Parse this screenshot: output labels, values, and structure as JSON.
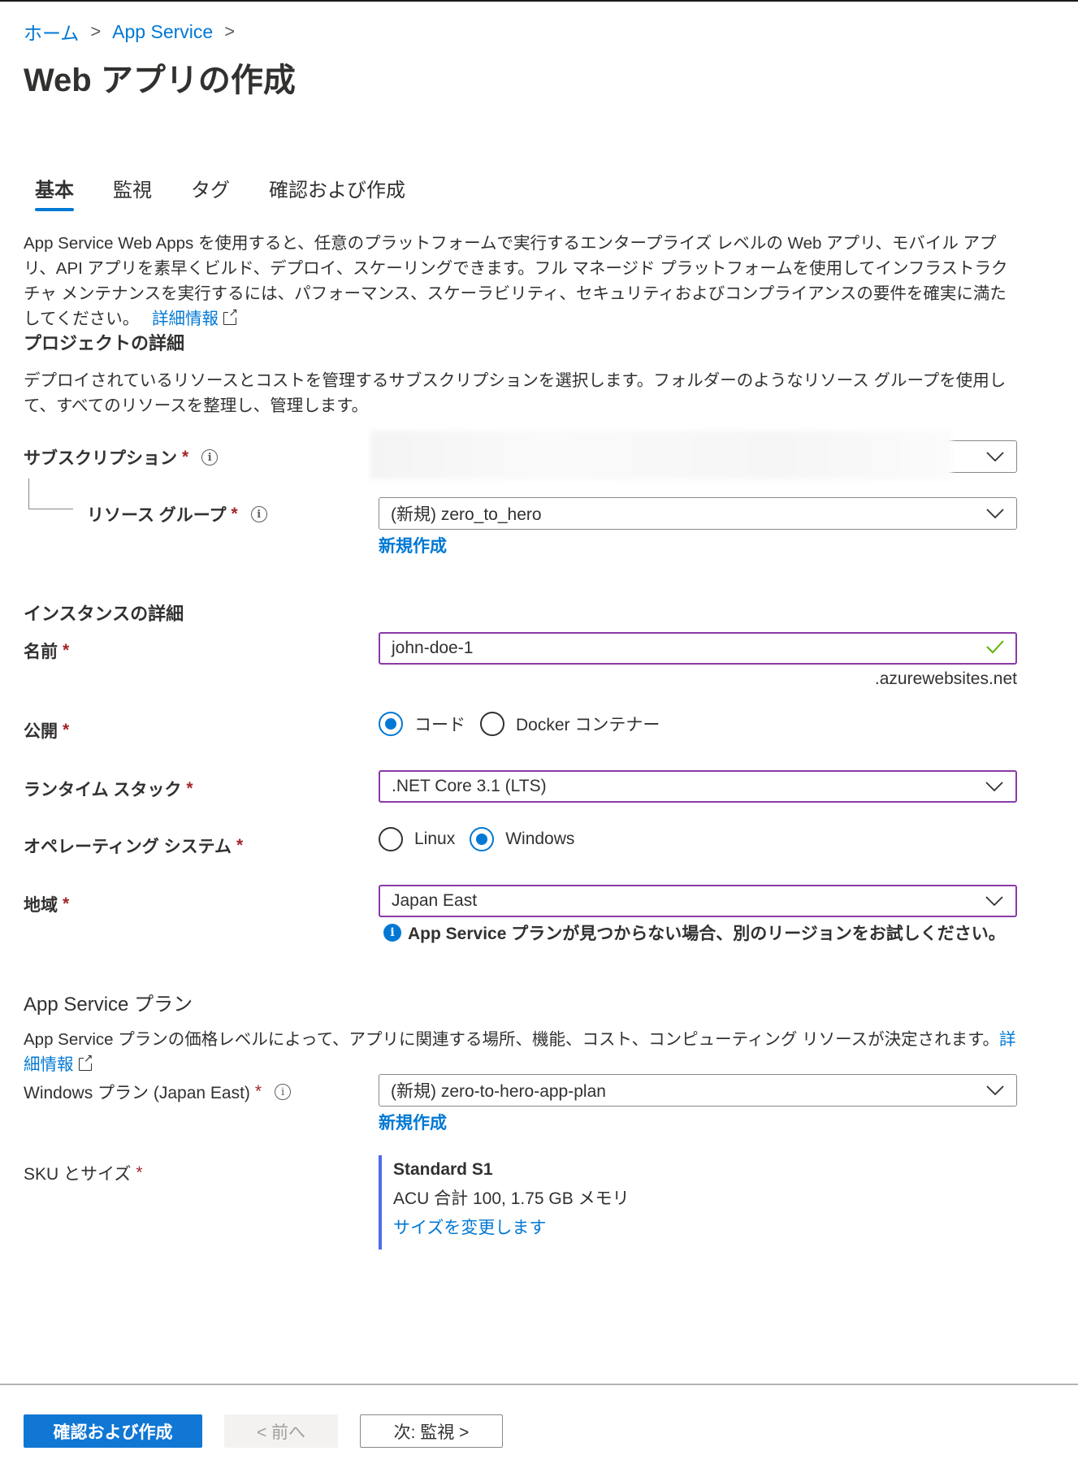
{
  "breadcrumb": [
    {
      "label": "ホーム"
    },
    {
      "label": "App Service"
    }
  ],
  "breadcrumb_separator": ">",
  "page_title": "Web アプリの作成",
  "tabs": [
    {
      "label": "基本",
      "active": true
    },
    {
      "label": "監視",
      "active": false
    },
    {
      "label": "タグ",
      "active": false
    },
    {
      "label": "確認および作成",
      "active": false
    }
  ],
  "intro": {
    "text": "App Service Web Apps を使用すると、任意のプラットフォームで実行するエンタープライズ レベルの Web アプリ、モバイル アプリ、API アプリを素早くビルド、デプロイ、スケーリングできます。フル マネージド プラットフォームを使用してインフラストラクチャ メンテナンスを実行するには、パフォーマンス、スケーラビリティ、セキュリティおよびコンプライアンスの要件を確実に満たしてください。",
    "link": "詳細情報"
  },
  "project": {
    "heading": "プロジェクトの詳細",
    "description": "デプロイされているリソースとコストを管理するサブスクリプションを選択します。フォルダーのようなリソース グループを使用して、すべてのリソースを整理し、管理します。",
    "subscription_label": "サブスクリプション",
    "subscription_value": "",
    "resource_group_label": "リソース グループ",
    "resource_group_value": "(新規) zero_to_hero",
    "create_new": "新規作成"
  },
  "instance": {
    "heading": "インスタンスの詳細",
    "name_label": "名前",
    "name_value": "john-doe-1",
    "name_suffix": ".azurewebsites.net",
    "publish_label": "公開",
    "publish_options": [
      {
        "label": "コード",
        "checked": true
      },
      {
        "label": "Docker コンテナー",
        "checked": false
      }
    ],
    "runtime_label": "ランタイム スタック",
    "runtime_value": ".NET Core 3.1 (LTS)",
    "os_label": "オペレーティング システム",
    "os_options": [
      {
        "label": "Linux",
        "checked": false
      },
      {
        "label": "Windows",
        "checked": true
      }
    ],
    "region_label": "地域",
    "region_value": "Japan East",
    "region_notice": "App Service プランが見つからない場合、別のリージョンをお試しください。"
  },
  "plan": {
    "heading": "App Service プラン",
    "description": "App Service プランの価格レベルによって、アプリに関連する場所、機能、コスト、コンピューティング リソースが決定されます。",
    "link": "詳細情報",
    "plan_label": "Windows プラン (Japan East)",
    "plan_value": "(新規) zero-to-hero-app-plan",
    "create_new": "新規作成",
    "sku_label": "SKU とサイズ",
    "sku_name": "Standard S1",
    "sku_detail": "ACU 合計 100, 1.75 GB メモリ",
    "sku_change": "サイズを変更します"
  },
  "required_mark": "*",
  "info_glyph": "i",
  "footer": {
    "review_create": "確認および作成",
    "previous": "< 前へ",
    "next": "次: 監視 >"
  },
  "colors": {
    "accent": "#0078d4",
    "focus_border": "#8a3aa6",
    "required": "#a4262c",
    "valid": "#5db300"
  }
}
